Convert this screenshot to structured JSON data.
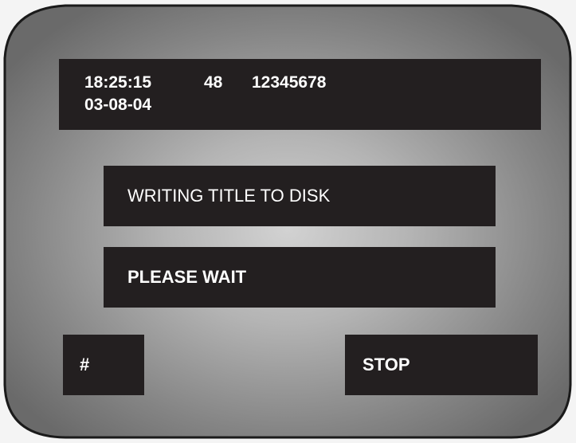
{
  "header": {
    "time": "18:25:15",
    "channel": "48",
    "id": "12345678",
    "date": "03-08-04"
  },
  "messages": {
    "line1": "WRITING TITLE TO DISK",
    "line2": "PLEASE WAIT"
  },
  "buttons": {
    "hash_label": "#",
    "stop_label": "STOP"
  },
  "colors": {
    "panel": "#231f20",
    "text": "#ffffff",
    "bezel_outline": "#1a1a1a",
    "screen_center": "#c8c8c8",
    "screen_edge": "#6e6e6e"
  }
}
